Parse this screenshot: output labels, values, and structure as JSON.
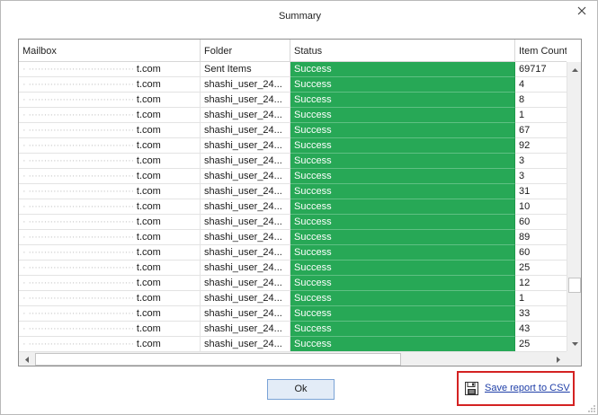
{
  "window": {
    "title": "Summary"
  },
  "grid": {
    "columns": [
      "Mailbox",
      "Folder",
      "Status",
      "Item Count"
    ],
    "rows": [
      {
        "mailbox_blur": "̶",
        "mailbox_suffix": "t.com",
        "folder": "Sent Items",
        "status": "Success",
        "count": "69717"
      },
      {
        "mailbox_blur": "̶",
        "mailbox_suffix": "t.com",
        "folder": "shashi_user_24...",
        "status": "Success",
        "count": "4"
      },
      {
        "mailbox_blur": "̶",
        "mailbox_suffix": "t.com",
        "folder": "shashi_user_24...",
        "status": "Success",
        "count": "8"
      },
      {
        "mailbox_blur": "̶",
        "mailbox_suffix": "t.com",
        "folder": "shashi_user_24...",
        "status": "Success",
        "count": "1"
      },
      {
        "mailbox_blur": "̶",
        "mailbox_suffix": "t.com",
        "folder": "shashi_user_24...",
        "status": "Success",
        "count": "67"
      },
      {
        "mailbox_blur": "̶",
        "mailbox_suffix": "t.com",
        "folder": "shashi_user_24...",
        "status": "Success",
        "count": "92"
      },
      {
        "mailbox_blur": "̶",
        "mailbox_suffix": "t.com",
        "folder": "shashi_user_24...",
        "status": "Success",
        "count": "3"
      },
      {
        "mailbox_blur": "̶",
        "mailbox_suffix": "t.com",
        "folder": "shashi_user_24...",
        "status": "Success",
        "count": "3"
      },
      {
        "mailbox_blur": "̶",
        "mailbox_suffix": "t.com",
        "folder": "shashi_user_24...",
        "status": "Success",
        "count": "31"
      },
      {
        "mailbox_blur": "̶",
        "mailbox_suffix": "t.com",
        "folder": "shashi_user_24...",
        "status": "Success",
        "count": "10"
      },
      {
        "mailbox_blur": "̶",
        "mailbox_suffix": "t.com",
        "folder": "shashi_user_24...",
        "status": "Success",
        "count": "60"
      },
      {
        "mailbox_blur": "̶",
        "mailbox_suffix": "t.com",
        "folder": "shashi_user_24...",
        "status": "Success",
        "count": "89"
      },
      {
        "mailbox_blur": "̶",
        "mailbox_suffix": "t.com",
        "folder": "shashi_user_24...",
        "status": "Success",
        "count": "60"
      },
      {
        "mailbox_blur": "̶",
        "mailbox_suffix": "t.com",
        "folder": "shashi_user_24...",
        "status": "Success",
        "count": "25"
      },
      {
        "mailbox_blur": "̶",
        "mailbox_suffix": "t.com",
        "folder": "shashi_user_24...",
        "status": "Success",
        "count": "12"
      },
      {
        "mailbox_blur": "̶",
        "mailbox_suffix": "t.com",
        "folder": "shashi_user_24...",
        "status": "Success",
        "count": "1"
      },
      {
        "mailbox_blur": "̶",
        "mailbox_suffix": "t.com",
        "folder": "shashi_user_24...",
        "status": "Success",
        "count": "33"
      },
      {
        "mailbox_blur": "̶",
        "mailbox_suffix": "t.com",
        "folder": "shashi_user_24...",
        "status": "Success",
        "count": "43"
      },
      {
        "mailbox_blur": "̶",
        "mailbox_suffix": "t.com",
        "folder": "shashi_user_24...",
        "status": "Success",
        "count": "25"
      }
    ]
  },
  "footer": {
    "ok_label": "Ok",
    "save_label": "Save report to CSV",
    "save_icon": "floppy-disk-icon"
  },
  "colors": {
    "status_success": "#27a856",
    "highlight_border": "#d42222",
    "link": "#1f3fa8",
    "ok_button_bg": "#e3ecf7"
  }
}
